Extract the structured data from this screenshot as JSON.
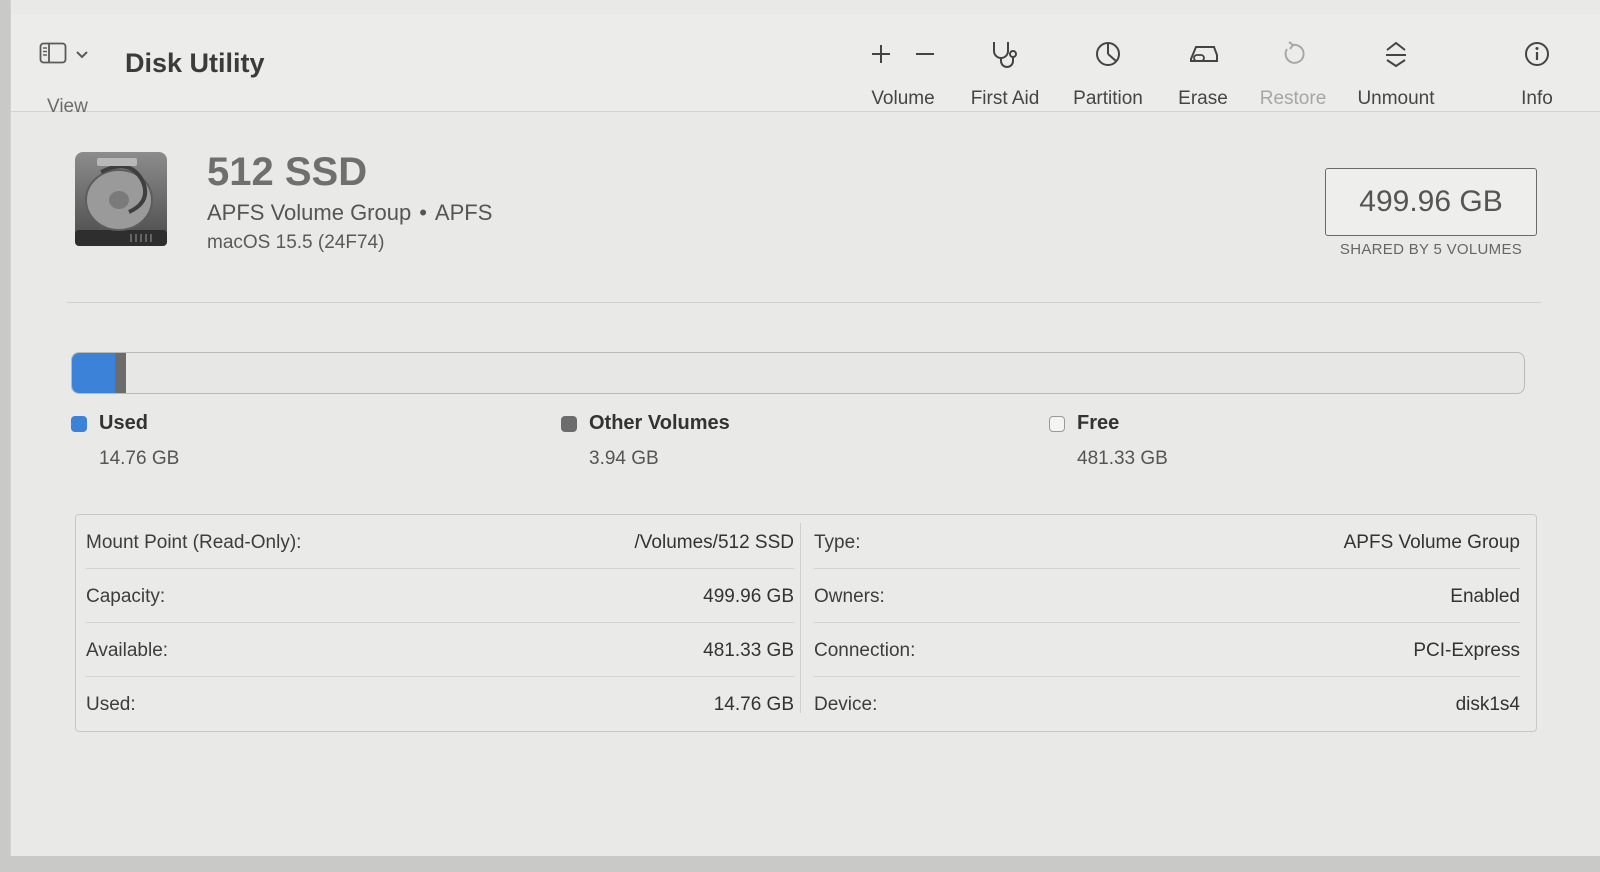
{
  "app": {
    "title": "Disk Utility",
    "view_label": "View"
  },
  "toolbar": {
    "volume_label": "Volume",
    "first_aid_label": "First Aid",
    "partition_label": "Partition",
    "erase_label": "Erase",
    "restore_label": "Restore",
    "unmount_label": "Unmount",
    "info_label": "Info"
  },
  "disk": {
    "name": "512 SSD",
    "type": "APFS Volume Group",
    "separator": "•",
    "format": "APFS",
    "os": "macOS 15.5 (24F74)",
    "size": "499.96 GB",
    "size_caption": "SHARED BY 5 VOLUMES"
  },
  "usage": {
    "segments": [
      {
        "name": "Used",
        "value": "14.76 GB",
        "gb": 14.76,
        "color": "#3b82d8"
      },
      {
        "name": "Other Volumes",
        "value": "3.94 GB",
        "gb": 3.94,
        "color": "#6c6c6c"
      },
      {
        "name": "Free",
        "value": "481.33 GB",
        "gb": 481.33,
        "color": "#f2f2f0"
      }
    ],
    "total_gb": 499.96
  },
  "info": {
    "left": [
      {
        "key": "Mount Point (Read-Only):",
        "value": "/Volumes/512 SSD"
      },
      {
        "key": "Capacity:",
        "value": "499.96 GB"
      },
      {
        "key": "Available:",
        "value": "481.33 GB"
      },
      {
        "key": "Used:",
        "value": "14.76 GB"
      }
    ],
    "right": [
      {
        "key": "Type:",
        "value": "APFS Volume Group"
      },
      {
        "key": "Owners:",
        "value": "Enabled"
      },
      {
        "key": "Connection:",
        "value": "PCI-Express"
      },
      {
        "key": "Device:",
        "value": "disk1s4"
      }
    ]
  }
}
